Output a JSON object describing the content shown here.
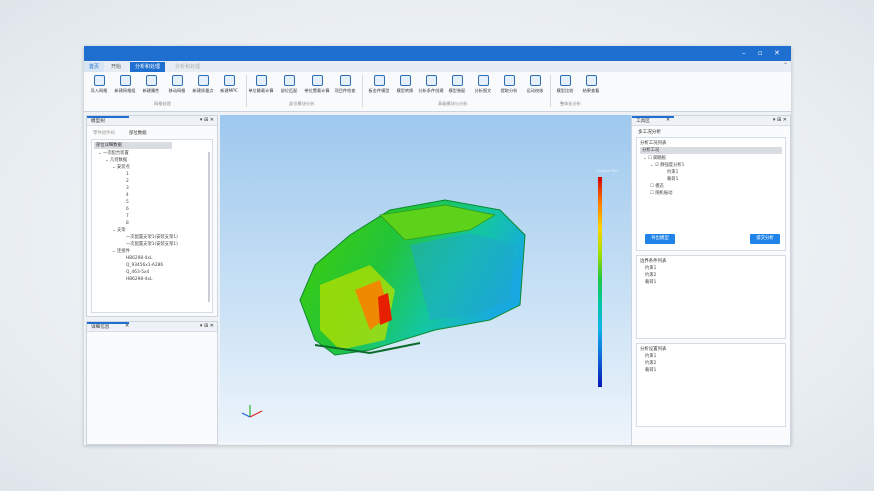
{
  "title_tabs": [
    "首页",
    "开始",
    "分析和处理",
    "分析和处理"
  ],
  "ribbon": {
    "buttons": [
      "导入网格",
      "新建网格组",
      "新建属性",
      "移动网格",
      "新建质量点",
      "新建MPC",
      "单位静载计算",
      "部位匹配",
      "带位置载计算",
      "项目件检查",
      "板金件模型",
      "模型转换",
      "分析条件创建",
      "模型装配",
      "分析报文",
      "提取分析",
      "运动校核",
      "模型比较",
      "结果查看"
    ],
    "groups": [
      "网格处理",
      "部位模块分析",
      "高级模块与分析",
      "整体化分析"
    ]
  },
  "model_tree": {
    "title": "模型树",
    "tabs": [
      "零件组件树",
      "部位数据"
    ],
    "header": "部位详细数据",
    "items": [
      "一次配合装置",
      "几何数据",
      "安装点",
      "1",
      "2",
      "3",
      "4",
      "5",
      "6",
      "7",
      "8",
      "支架",
      "一次配置支架1(安装支架1)",
      "一次配置支架1(安装支架1)",
      "连接件",
      "HB6298-4xL",
      "Q_93456x1-A286",
      "Q_463-5x4",
      "HB6298-4xL"
    ]
  },
  "detail_panel": {
    "title": "详细信息"
  },
  "legend_label": "Contour Plot",
  "toolbox": {
    "title": "工具区",
    "section_title": "多工况分析",
    "list_title": "分析工况列表",
    "header": "分析工况",
    "tree": [
      "脚踏板",
      "静强度分析1",
      "约束1",
      "载荷1",
      "模态",
      "随机振动"
    ],
    "export_button": "导出模型",
    "submit_button": "提交分析",
    "constraint_title": "边界条件列表",
    "constraint_items": [
      "约束1",
      "约束2",
      "载荷1"
    ],
    "setting_title": "分析设置列表",
    "setting_items": [
      "约束1",
      "约束2",
      "载荷1"
    ]
  }
}
